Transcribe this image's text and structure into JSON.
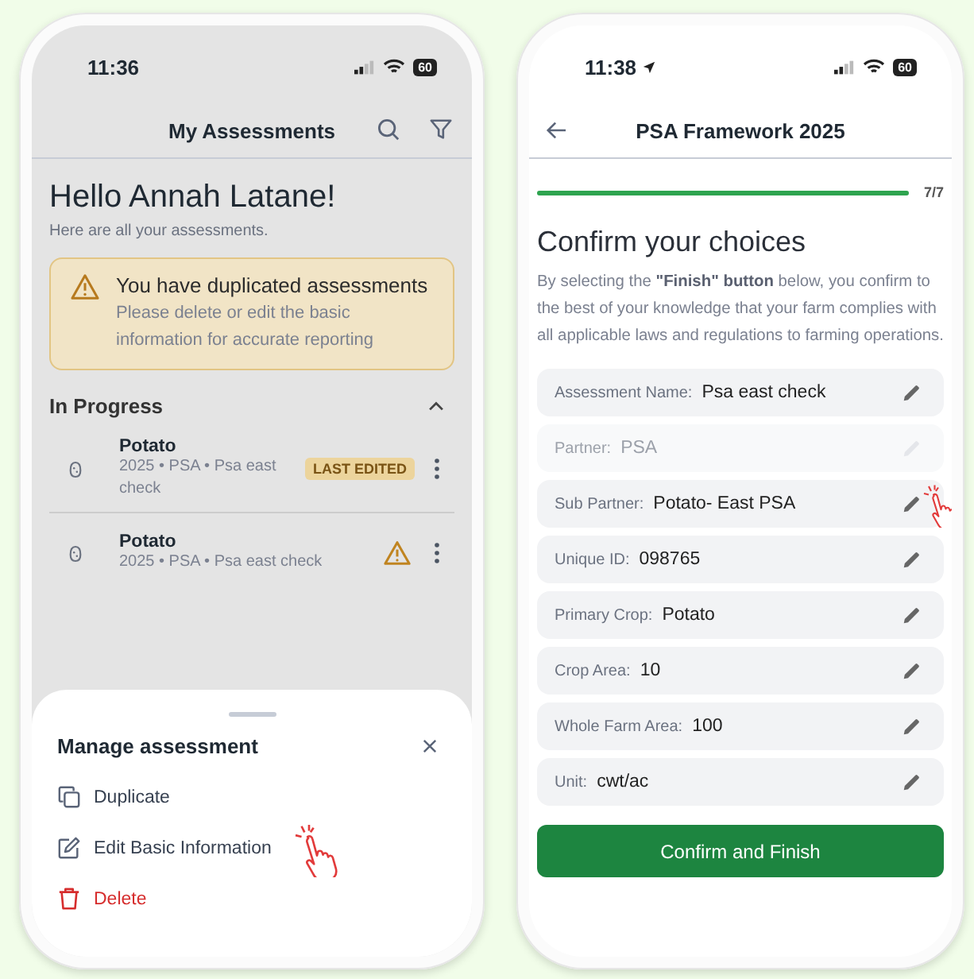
{
  "left_screen": {
    "status_bar": {
      "time": "11:36",
      "battery": "60"
    },
    "header": {
      "title": "My Assessments"
    },
    "greeting": "Hello Annah Latane!",
    "subtitle": "Here are all your assessments.",
    "alert": {
      "title": "You have duplicated assessments",
      "message": "Please delete or edit the basic information for accurate reporting"
    },
    "section": {
      "title": "In Progress",
      "expanded": true
    },
    "assessments": [
      {
        "name": "Potato",
        "details": "2025 • PSA • Psa east check",
        "badge": "LAST EDITED",
        "warning": false
      },
      {
        "name": "Potato",
        "details": "2025 • PSA • Psa east check",
        "warning": true
      }
    ],
    "sheet": {
      "title": "Manage assessment",
      "actions": [
        {
          "label": "Duplicate",
          "kind": "duplicate"
        },
        {
          "label": "Edit Basic Information",
          "kind": "edit"
        },
        {
          "label": "Delete",
          "kind": "delete"
        }
      ]
    }
  },
  "right_screen": {
    "status_bar": {
      "time": "11:38",
      "battery": "60"
    },
    "header": {
      "title": "PSA Framework 2025"
    },
    "progress": {
      "level": 1,
      "reading": "7/7"
    },
    "heading": "Confirm your choices",
    "intro": "By selecting the  **\"Finish\" button**  below, you confirm to the best of your knowledge that your farm complies with all applicable laws and regulations to farming operations.",
    "fields": [
      {
        "label": "Assessment Name:",
        "value": "Psa east check",
        "disabled": false
      },
      {
        "label": "Partner:",
        "value": "PSA",
        "disabled": true
      },
      {
        "label": "Sub Partner:",
        "value": "Potato- East PSA",
        "disabled": false
      },
      {
        "label": "Unique ID:",
        "value": "098765",
        "disabled": false
      },
      {
        "label": "Primary Crop:",
        "value": "Potato",
        "disabled": false
      },
      {
        "label": "Crop Area:",
        "value": "10",
        "disabled": false
      },
      {
        "label": "Whole Farm Area:",
        "value": "100",
        "disabled": false
      },
      {
        "label": "Unit:",
        "value": "cwt/ac",
        "disabled": false
      }
    ],
    "button": "Confirm and Finish"
  }
}
